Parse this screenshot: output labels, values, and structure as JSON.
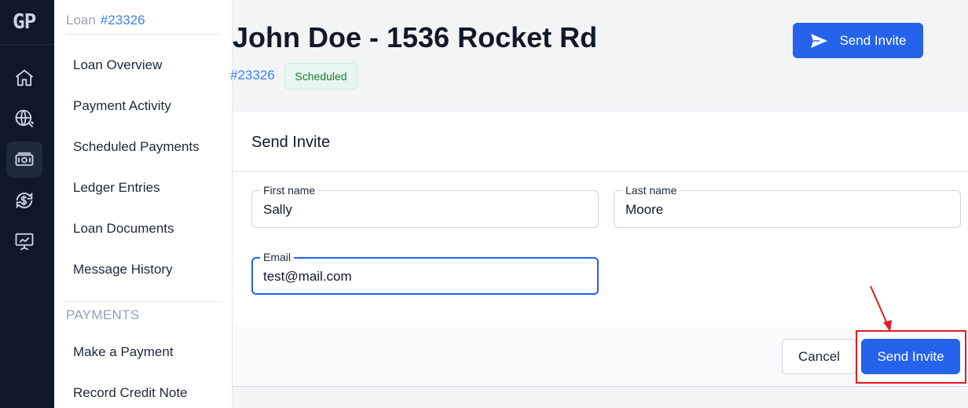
{
  "rail": {
    "logo": "GP",
    "icons": [
      "home-icon",
      "globe-icon",
      "money-icon",
      "dollar-exchange-icon",
      "chart-presentation-icon"
    ]
  },
  "subnav": {
    "loan_label": "Loan",
    "loan_number": "#23326",
    "items": [
      {
        "label": "Loan Overview"
      },
      {
        "label": "Payment Activity"
      },
      {
        "label": "Scheduled Payments"
      },
      {
        "label": "Ledger Entries"
      },
      {
        "label": "Loan Documents"
      },
      {
        "label": "Message History"
      }
    ],
    "payments_section": "PAYMENTS",
    "payment_items": [
      {
        "label": "Make a Payment"
      },
      {
        "label": "Record Credit Note"
      }
    ]
  },
  "header": {
    "title": "John Doe - 1536 Rocket Rd",
    "loan_id": "#23326",
    "status_badge": "Scheduled",
    "send_invite_label": "Send Invite"
  },
  "modal": {
    "title": "Send Invite",
    "first_name_label": "First name",
    "first_name_value": "Sally",
    "last_name_label": "Last name",
    "last_name_value": "Moore",
    "email_label": "Email",
    "email_value": "test@mail.com",
    "cancel_label": "Cancel",
    "submit_label": "Send Invite"
  },
  "colors": {
    "primary": "#2563eb",
    "rail_bg": "#0f172a",
    "highlight": "#e11d1d",
    "badge_text": "#15803d"
  }
}
